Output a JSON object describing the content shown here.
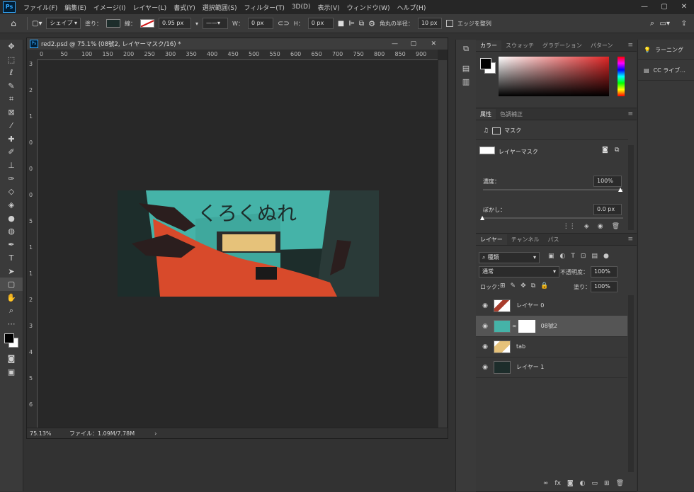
{
  "app": {
    "logo": "Ps",
    "menus": [
      "ファイル(F)",
      "編集(E)",
      "イメージ(I)",
      "レイヤー(L)",
      "書式(Y)",
      "選択範囲(S)",
      "フィルター(T)",
      "3D(D)",
      "表示(V)",
      "ウィンドウ(W)",
      "ヘルプ(H)"
    ]
  },
  "window_controls": {
    "minimize": "—",
    "maximize": "▢",
    "close": "✕"
  },
  "options": {
    "mode": "シェイプ",
    "fill_label": "塗り：",
    "stroke_label": "線：",
    "stroke_width": "0.95 px",
    "w_label": "W：",
    "w_value": "0 px",
    "h_label": "H：",
    "h_value": "0 px",
    "radius_label": "角丸の半径：",
    "radius_value": "10 px",
    "align_edges": "エッジを整列",
    "fill_color": "#1d2d2b",
    "stroke_color": "#ffffff"
  },
  "document": {
    "title": "red2.psd @ 75.1% (08號2, レイヤーマスク/16) *",
    "zoom": "75.13%",
    "file_info": "ファイル：1.09M/7.78M",
    "ruler_h": [
      "0",
      "50",
      "100",
      "150",
      "200",
      "250",
      "300",
      "350",
      "400",
      "450",
      "500",
      "550",
      "600",
      "650",
      "700",
      "750",
      "800",
      "850",
      "900"
    ],
    "ruler_v": [
      "3",
      "2",
      "1",
      "0",
      "0",
      "0",
      "5",
      "1",
      "1",
      "2",
      "3",
      "4",
      "5",
      "6"
    ],
    "artwork_text": "くろくぬれ"
  },
  "color_panel": {
    "tabs": [
      "カラー",
      "スウォッチ",
      "グラデーション",
      "パターン"
    ],
    "fg": "#000000",
    "bg": "#ffffff",
    "hue": "#e02626"
  },
  "properties_panel": {
    "tabs": [
      "属性",
      "色調補正"
    ],
    "mask_label": "マスク",
    "layer_mask_label": "レイヤーマスク",
    "density_label": "濃度：",
    "density_value": "100%",
    "feather_label": "ぼかし：",
    "feather_value": "0.0 px"
  },
  "layers_panel": {
    "tabs": [
      "レイヤー",
      "チャンネル",
      "パス"
    ],
    "filter_kind": "種類",
    "blend_mode": "通常",
    "opacity_label": "不透明度：",
    "opacity_value": "100%",
    "lock_label": "ロック：",
    "fill_label": "塗り：",
    "fill_value": "100%",
    "layers": [
      {
        "name": "レイヤー 0",
        "thumb": "#a83c2c",
        "selected": false
      },
      {
        "name": "08號2",
        "thumb": "#45b3a8",
        "selected": true
      },
      {
        "name": "tab",
        "thumb": "#e6c27a",
        "selected": false
      },
      {
        "name": "レイヤー 1",
        "thumb": "#1d2d2b",
        "selected": false
      }
    ]
  },
  "learn_panel": {
    "items": [
      "ラーニング",
      "CC ライブ..."
    ]
  }
}
